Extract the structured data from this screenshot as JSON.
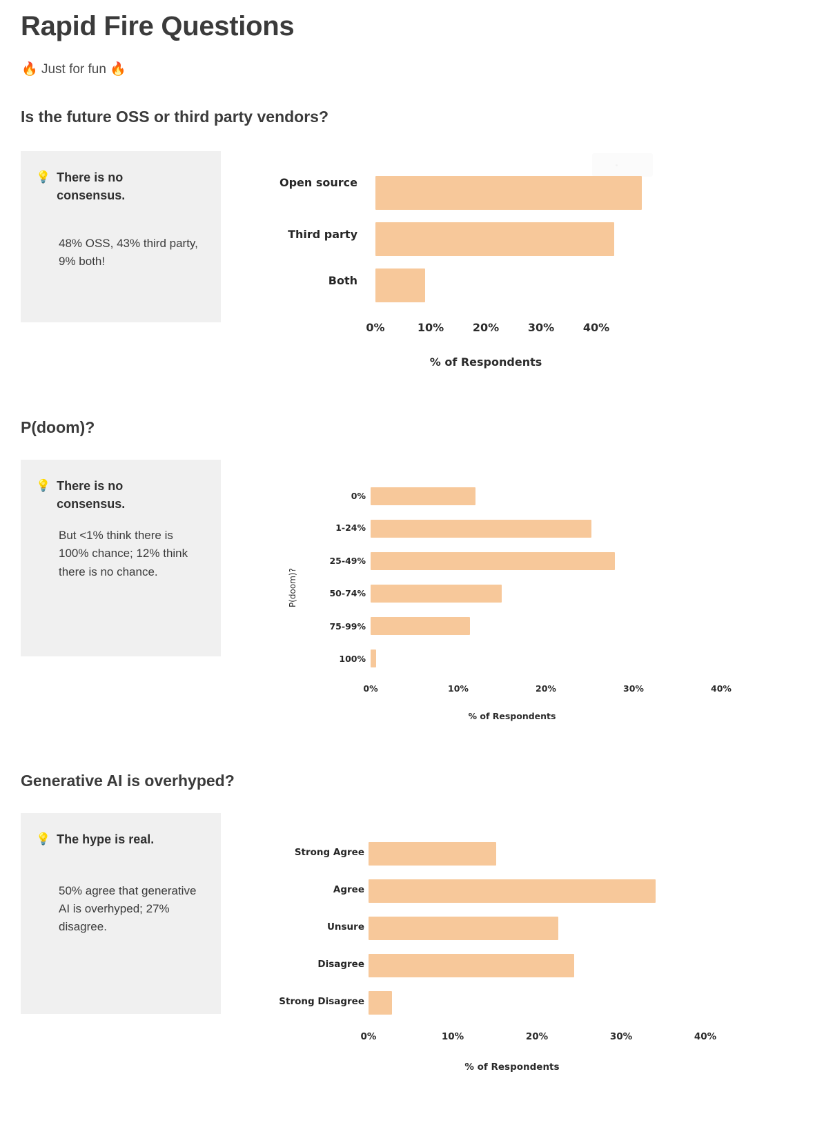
{
  "deck": {
    "title": "Rapid Fire Questions",
    "subtitle_text": "Just for fun",
    "subtitle_emoji_left": "🔥",
    "subtitle_emoji_right": "🔥",
    "bulb_icon": "💡",
    "accent_bar_color": "#f7c89a",
    "callout_bg_color": "#f0f0f0",
    "text_color": "#3b3b3b"
  },
  "sections": [
    {
      "title": "Is the future OSS or third party vendors?",
      "callout": {
        "headline": "There is no consensus.",
        "body": "48% OSS, 43% third party, 9% both!"
      }
    },
    {
      "title": "P(doom)?",
      "callout": {
        "headline": "There is no consensus.",
        "body": "But <1% think there is 100% chance; 12% think there is no chance."
      }
    },
    {
      "title": "Generative AI is overhyped?",
      "callout": {
        "headline": "The hype is real.",
        "body": "50% agree that generative AI is overhyped; 27% disagree."
      }
    }
  ],
  "chart_data": [
    {
      "type": "bar",
      "orientation": "horizontal",
      "title": "",
      "categories": [
        "Open source",
        "Third party",
        "Both"
      ],
      "values": [
        48,
        43,
        9
      ],
      "xlabel": "% of Respondents",
      "ylabel": "",
      "xlim": [
        0,
        48
      ],
      "xticks": [
        "0%",
        "10%",
        "20%",
        "30%",
        "40%"
      ],
      "xtick_values": [
        0,
        10,
        20,
        30,
        40
      ],
      "grid": false,
      "legend": "none",
      "bar_color": "#f7c89a"
    },
    {
      "type": "bar",
      "orientation": "horizontal",
      "title": "",
      "categories": [
        "0%",
        "1-24%",
        "25-49%",
        "50-74%",
        "75-99%",
        "100%"
      ],
      "values": [
        12,
        25,
        28,
        15,
        11,
        0.6
      ],
      "xlabel": "% of Respondents",
      "ylabel": "P(doom)?",
      "xlim": [
        0,
        40
      ],
      "xticks": [
        "0%",
        "10%",
        "20%",
        "30%",
        "40%"
      ],
      "xtick_values": [
        0,
        10,
        20,
        30,
        40
      ],
      "grid": false,
      "legend": "none",
      "bar_color": "#f7c89a"
    },
    {
      "type": "bar",
      "orientation": "horizontal",
      "title": "",
      "categories": [
        "Strong Agree",
        "Agree",
        "Unsure",
        "Disagree",
        "Strong Disagree"
      ],
      "values": [
        15,
        34,
        22,
        24,
        3
      ],
      "xlabel": "% of Respondents",
      "ylabel": "",
      "xlim": [
        0,
        40
      ],
      "xticks": [
        "0%",
        "10%",
        "20%",
        "30%",
        "40%"
      ],
      "xtick_values": [
        0,
        10,
        20,
        30,
        40
      ],
      "grid": false,
      "legend": "none",
      "bar_color": "#f7c89a"
    }
  ]
}
